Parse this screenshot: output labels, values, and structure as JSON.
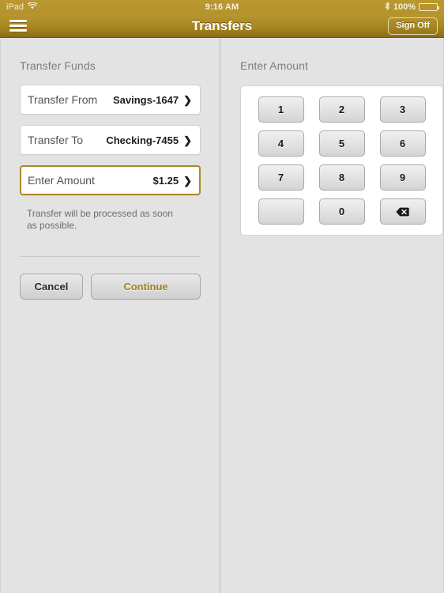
{
  "status_bar": {
    "device_label": "iPad",
    "wifi_icon": "wifi-icon",
    "time": "9:16 AM",
    "bluetooth_icon": "bluetooth-icon",
    "battery_percent": "100%",
    "battery_icon": "battery-full-icon"
  },
  "toolbar": {
    "menu_icon": "hamburger-menu-icon",
    "title": "Transfers",
    "sign_off_label": "Sign Off",
    "accent_color": "#a9871f"
  },
  "left_pane": {
    "section_title": "Transfer Funds",
    "rows": [
      {
        "label": "Transfer From",
        "value": "Savings-1647",
        "chevron": "❯",
        "active": false
      },
      {
        "label": "Transfer To",
        "value": "Checking-7455",
        "chevron": "❯",
        "active": false
      },
      {
        "label": "Enter Amount",
        "value": "$1.25",
        "chevron": "❯",
        "active": true
      }
    ],
    "note": "Transfer will be processed as soon as possible.",
    "cancel_label": "Cancel",
    "continue_label": "Continue",
    "continue_color": "#a07f1f"
  },
  "right_pane": {
    "section_title": "Enter Amount",
    "keypad": {
      "keys": [
        {
          "label": "1",
          "name": "keypad-key-1",
          "type": "digit"
        },
        {
          "label": "2",
          "name": "keypad-key-2",
          "type": "digit"
        },
        {
          "label": "3",
          "name": "keypad-key-3",
          "type": "digit"
        },
        {
          "label": "4",
          "name": "keypad-key-4",
          "type": "digit"
        },
        {
          "label": "5",
          "name": "keypad-key-5",
          "type": "digit"
        },
        {
          "label": "6",
          "name": "keypad-key-6",
          "type": "digit"
        },
        {
          "label": "7",
          "name": "keypad-key-7",
          "type": "digit"
        },
        {
          "label": "8",
          "name": "keypad-key-8",
          "type": "digit"
        },
        {
          "label": "9",
          "name": "keypad-key-9",
          "type": "digit"
        },
        {
          "label": "",
          "name": "keypad-key-blank",
          "type": "blank"
        },
        {
          "label": "0",
          "name": "keypad-key-0",
          "type": "digit"
        },
        {
          "label": "",
          "name": "keypad-key-backspace",
          "type": "backspace"
        }
      ]
    }
  }
}
